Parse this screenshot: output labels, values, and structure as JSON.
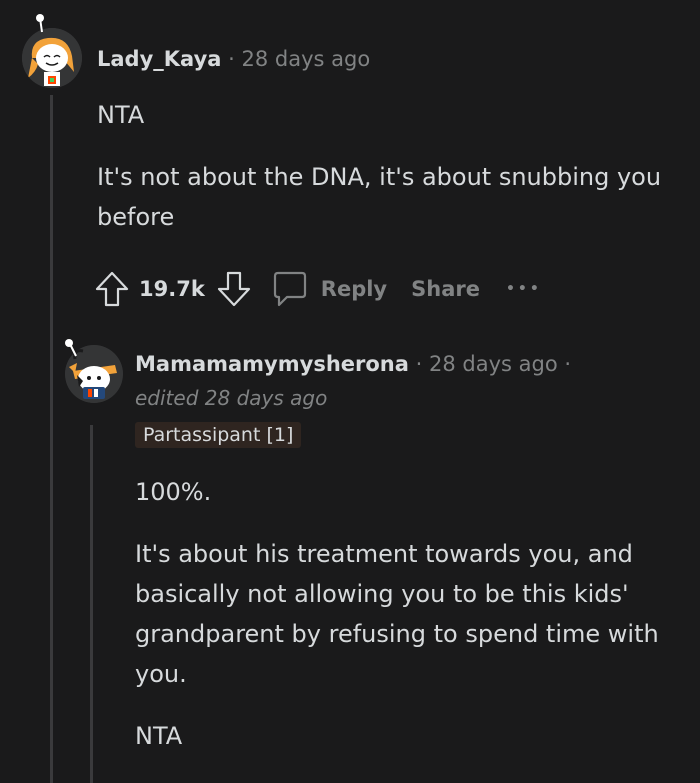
{
  "comments": [
    {
      "author": "Lady_Kaya",
      "separator": "·",
      "time": "28 days ago",
      "body": [
        "NTA",
        "It's not about the DNA, it's about snubbing you before"
      ],
      "score": "19.7k",
      "reply_label": "Reply",
      "share_label": "Share",
      "more_label": "•••"
    },
    {
      "author": "Mamamamymysherona",
      "separator": "·",
      "time": "28 days ago",
      "separator2": "·",
      "edited": "edited 28 days ago",
      "flair": "Partassipant [1]",
      "body": [
        "100%.",
        "It's about his treatment towards you, and basically not allowing you to be this kids' grandparent by refusing to spend time with you.",
        "NTA"
      ]
    }
  ],
  "icons": {
    "upvote": "arrow-up-icon",
    "downvote": "arrow-down-icon",
    "reply": "speech-bubble-icon",
    "more": "ellipsis-icon"
  },
  "colors": {
    "background": "#1a1a1b",
    "text": "#d7dadc",
    "muted": "#818384",
    "thread_line": "#3a3a3c",
    "flair_bg": "#2f2520"
  }
}
